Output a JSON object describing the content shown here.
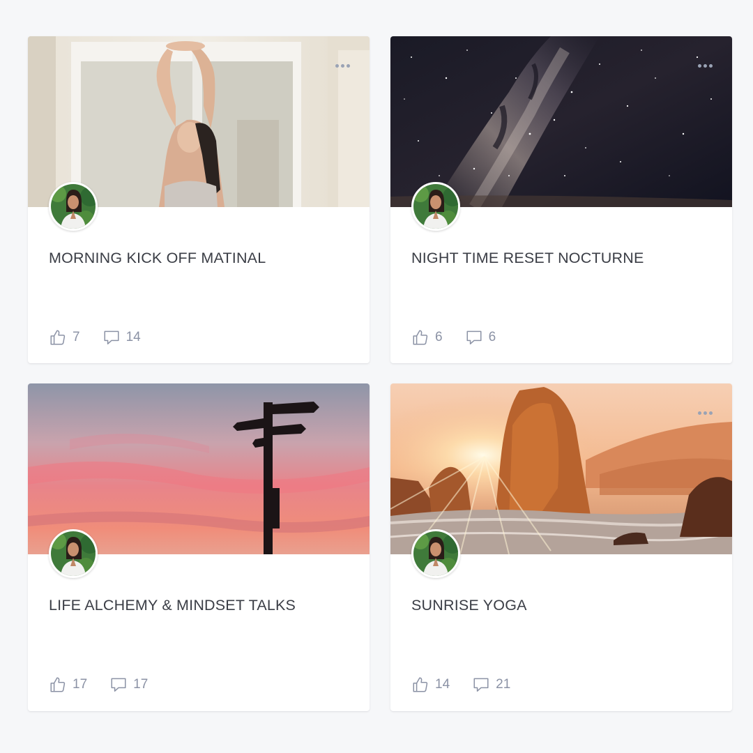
{
  "cards": [
    {
      "title": "MORNING KICK OFF MATINAL",
      "likes": "7",
      "comments": "14",
      "cover": "yoga-stretch-photo",
      "has_more_menu": true
    },
    {
      "title": "NIGHT TIME RESET NOCTURNE",
      "likes": "6",
      "comments": "6",
      "cover": "milky-way-photo",
      "has_more_menu": true
    },
    {
      "title": "LIFE ALCHEMY & MINDSET TALKS",
      "likes": "17",
      "comments": "17",
      "cover": "signpost-sunset-photo",
      "has_more_menu": false
    },
    {
      "title": "SUNRISE YOGA",
      "likes": "14",
      "comments": "21",
      "cover": "sea-rock-sunrise-photo",
      "has_more_menu": true
    }
  ],
  "icons": {
    "like": "thumbs-up-icon",
    "comment": "speech-bubble-icon",
    "more": "more-dots-icon"
  },
  "colors": {
    "background": "#f6f7f9",
    "card": "#ffffff",
    "title": "#3a3d45",
    "meta": "#8b92a5"
  }
}
